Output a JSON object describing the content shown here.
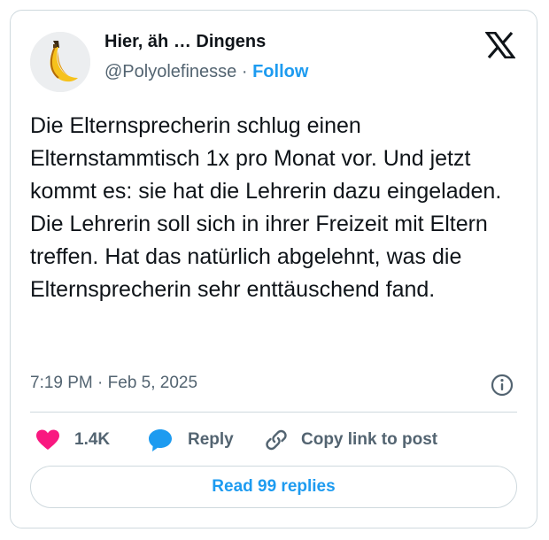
{
  "author": {
    "name": "Hier, äh … Dingens",
    "handle": "@Polyolefinesse",
    "separator": "·",
    "follow_label": "Follow"
  },
  "tweet": {
    "paragraphs": [
      "Die Elternsprecherin schlug einen Elternstammtisch 1x pro Monat vor. Und jetzt kommt es: sie hat die Lehrerin dazu eingeladen.",
      "Die Lehrerin soll sich in ihrer Freizeit mit Eltern treffen. Hat das natürlich abgelehnt, was die Elternsprecherin sehr enttäuschend fand."
    ],
    "timestamp": "7:19 PM · Feb 5, 2025"
  },
  "actions": {
    "likes_count": "1.4K",
    "reply_label": "Reply",
    "copy_label": "Copy link to post"
  },
  "read_replies_label": "Read 99 replies",
  "icons": {
    "brand": "x-logo-icon",
    "info": "info-icon",
    "like": "heart-icon",
    "reply": "speech-bubble-icon",
    "copy": "link-icon"
  },
  "colors": {
    "accent": "#1d9bf0",
    "heart": "#f91880",
    "text": "#0f1419",
    "muted": "#536471",
    "border": "#cfd9de"
  }
}
